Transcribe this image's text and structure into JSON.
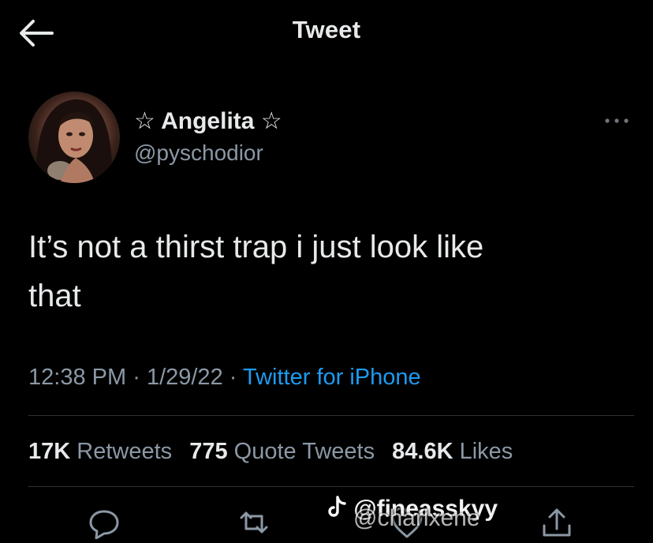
{
  "header": {
    "back_icon": "arrow-left-icon",
    "title": "Tweet"
  },
  "tweet": {
    "display_name": "☆ Angelita ☆",
    "handle": "@pyschodior",
    "more_icon": "ellipsis-icon",
    "text": "It’s not a thirst trap i just look like\nthat",
    "time": "12:38 PM",
    "date": "1/29/22",
    "separator": "·",
    "source": "Twitter for iPhone"
  },
  "stats": {
    "retweets_count": "17K",
    "retweets_label": "Retweets",
    "quotes_count": "775",
    "quotes_label": "Quote Tweets",
    "likes_count": "84.6K",
    "likes_label": "Likes"
  },
  "actions": {
    "reply_icon": "reply-icon",
    "retweet_icon": "retweet-icon",
    "like_icon": "heart-icon",
    "share_icon": "share-icon"
  },
  "watermark": {
    "icon": "tiktok-icon",
    "handle_1": "@fineasskyy",
    "handle_2": "@charlxene"
  },
  "colors": {
    "background": "#000000",
    "text": "#e7e9ea",
    "secondary": "#8b98a5",
    "link": "#1d9bf0",
    "divider": "#2f3336"
  }
}
